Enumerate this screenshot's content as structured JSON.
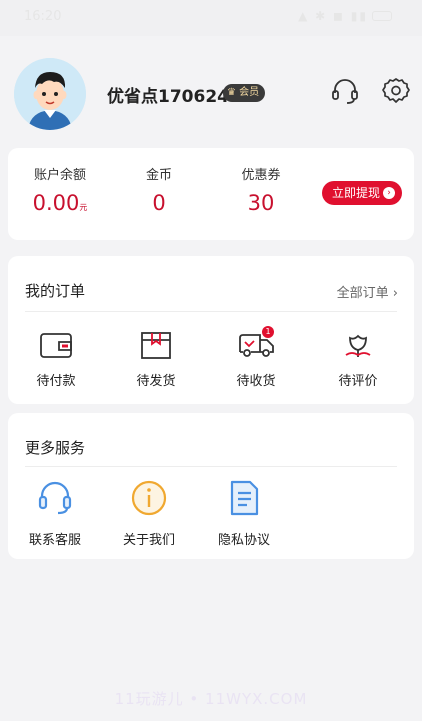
{
  "status_bar": {
    "time": "16:20"
  },
  "profile": {
    "username": "优省点170624",
    "vip_label": "会员"
  },
  "balance": {
    "items": [
      {
        "label": "账户余额",
        "value": "0.00",
        "unit": "元"
      },
      {
        "label": "金币",
        "value": "0"
      },
      {
        "label": "优惠券",
        "value": "30"
      }
    ],
    "withdraw_label": "立即提现"
  },
  "orders": {
    "title": "我的订单",
    "all_label": "全部订单",
    "items": [
      {
        "label": "待付款",
        "icon": "wallet-icon"
      },
      {
        "label": "待发货",
        "icon": "package-icon"
      },
      {
        "label": "待收货",
        "icon": "truck-icon",
        "badge": "1"
      },
      {
        "label": "待评价",
        "icon": "flower-icon"
      }
    ]
  },
  "services": {
    "title": "更多服务",
    "items": [
      {
        "label": "联系客服",
        "icon": "headset-icon"
      },
      {
        "label": "关于我们",
        "icon": "info-icon"
      },
      {
        "label": "隐私协议",
        "icon": "document-icon"
      }
    ]
  },
  "colors": {
    "accent": "#e0102f",
    "value_red": "#c8102e",
    "service_blue": "#4a90e2",
    "service_orange": "#f0a830"
  },
  "watermark": "11玩游儿 • 11WYX.COM"
}
